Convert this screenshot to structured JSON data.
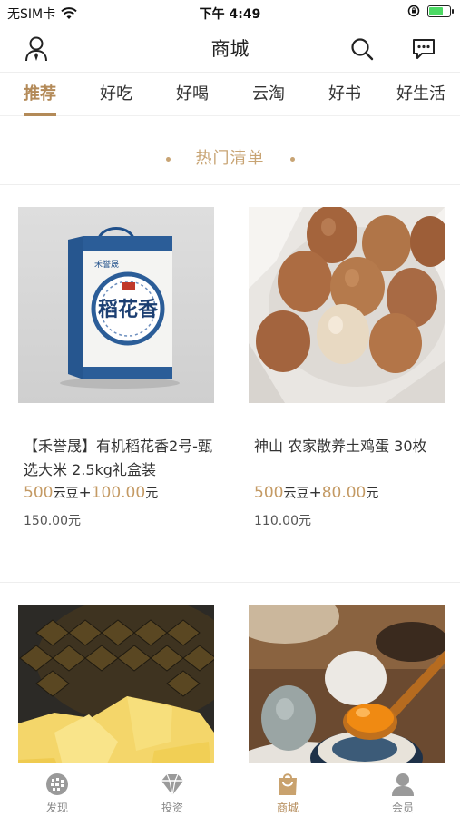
{
  "status": {
    "carrier": "无SIM卡",
    "time": "下午 4:49",
    "battery_level": 0.75,
    "battery_color": "#4cd964"
  },
  "header": {
    "title": "商城",
    "icons": [
      "user-icon",
      "search-icon",
      "message-icon"
    ]
  },
  "tabs": [
    {
      "label": "推荐",
      "active": true
    },
    {
      "label": "好吃",
      "active": false
    },
    {
      "label": "好喝",
      "active": false
    },
    {
      "label": "云淘",
      "active": false
    },
    {
      "label": "好书",
      "active": false
    },
    {
      "label": "好生活",
      "active": false
    }
  ],
  "section": {
    "title": "热门清单"
  },
  "products": [
    {
      "name": "【禾誉晟】有机稻花香2号-甄选大米 2.5kg礼盒装",
      "points": "500",
      "points_unit": "云豆",
      "plus": "+",
      "cash": "100.00",
      "cash_unit": "元",
      "original_price": "150.00元",
      "image": "rice-gift-box",
      "box_brand": "禾誉晟",
      "box_title": "稻花香"
    },
    {
      "name": "神山 农家散养土鸡蛋 30枚",
      "points": "500",
      "points_unit": "云豆",
      "plus": "+",
      "cash": "80.00",
      "cash_unit": "元",
      "original_price": "110.00元",
      "image": "eggs-in-cloth"
    },
    {
      "name": "",
      "image": "pineapple"
    },
    {
      "name": "",
      "image": "salted-duck-egg"
    }
  ],
  "bottom_nav": [
    {
      "label": "发现",
      "icon": "discover-icon",
      "active": false
    },
    {
      "label": "投资",
      "icon": "diamond-icon",
      "active": false
    },
    {
      "label": "商城",
      "icon": "shopping-bag-icon",
      "active": true
    },
    {
      "label": "会员",
      "icon": "member-icon",
      "active": false
    }
  ],
  "colors": {
    "accent": "#b38a58",
    "price_gold": "#c49a64"
  }
}
